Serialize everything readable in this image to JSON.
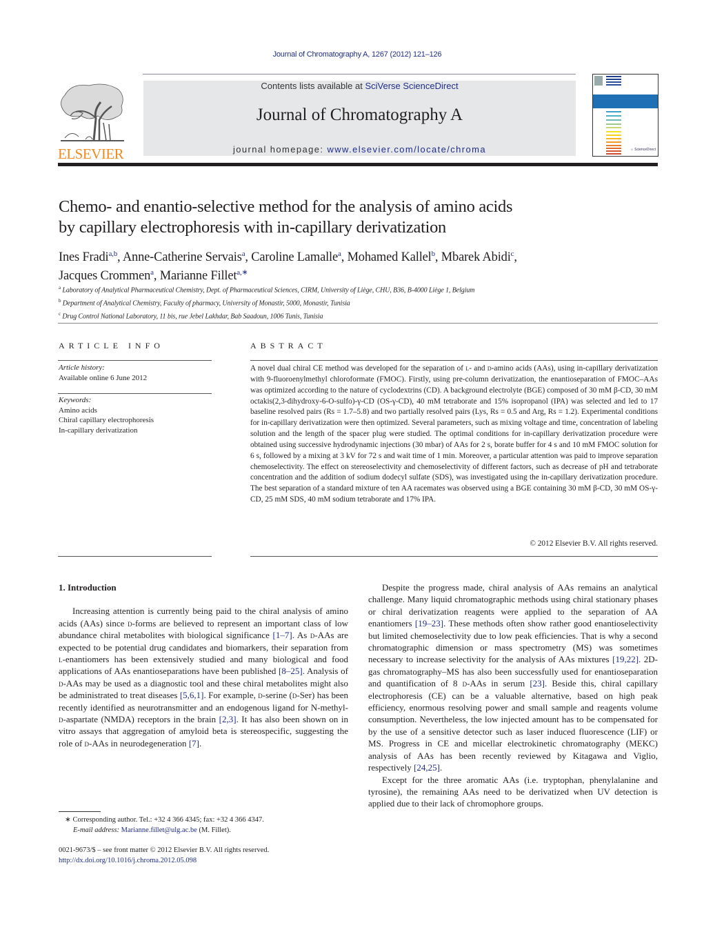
{
  "header": {
    "citation": "Journal of Chromatography A, 1267 (2012) 121–126",
    "contents_prefix": "Contents lists available at ",
    "contents_link": "SciVerse ScienceDirect",
    "journal_title": "Journal of Chromatography A",
    "homepage_prefix": "journal homepage: ",
    "homepage_link": "www.elsevier.com/locate/chroma",
    "publisher_logo": "ELSEVIER",
    "logo_icon": "elsevier-tree-icon",
    "cover_icon": "journal-cover-icon",
    "cover_colors": [
      "#1f3f8f",
      "#1f3f8f",
      "#2a4f9a",
      "#2a4f9a",
      "#1f6fb4",
      "#3aa0d0",
      "#4fb1c8",
      "#6fb8b0",
      "#9cc88a",
      "#c8d870",
      "#f4e21a",
      "#f6d31a",
      "#f4b520",
      "#ef9a24",
      "#e6802a",
      "#de6a2c",
      "#d6552e",
      "#cf4a2e"
    ]
  },
  "article": {
    "title_line1": "Chemo- and enantio-selective method for the analysis of amino acids",
    "title_line2": "by capillary electrophoresis with in-capillary derivatization",
    "authors": [
      {
        "name": "Ines Fradi",
        "aff": "a,b",
        "sep": ", "
      },
      {
        "name": "Anne-Catherine Servais",
        "aff": "a",
        "sep": ", "
      },
      {
        "name": "Caroline Lamalle",
        "aff": "a",
        "sep": ", "
      },
      {
        "name": "Mohamed Kallel",
        "aff": "b",
        "sep": ", "
      },
      {
        "name": "Mbarek Abidi",
        "aff": "c",
        "sep": ","
      },
      {
        "name": "Jacques Crommen",
        "aff": "a",
        "sep": ", "
      },
      {
        "name": "Marianne Fillet",
        "aff": "a,∗",
        "sep": ""
      }
    ],
    "affiliations": [
      {
        "key": "a",
        "text": "Laboratory of Analytical Pharmaceutical Chemistry, Dept. of Pharmaceutical Sciences, CIRM, University of Liège, CHU, B36, B-4000 Liège 1, Belgium"
      },
      {
        "key": "b",
        "text": "Department of Analytical Chemistry, Faculty of pharmacy, University of Monastir, 5000, Monastir, Tunisia"
      },
      {
        "key": "c",
        "text": "Drug Control National Laboratory, 11 bis, rue Jebel Lakhdar, Bab Saadoun, 1006 Tunis, Tunisia"
      }
    ]
  },
  "article_info": {
    "heading": "ARTICLE INFO",
    "history_label": "Article history:",
    "history_value": "Available online 6 June 2012",
    "keywords_label": "Keywords:",
    "keywords": [
      "Amino acids",
      "Chiral capillary electrophoresis",
      "In-capillary derivatization"
    ]
  },
  "abstract": {
    "heading": "ABSTRACT",
    "p1": "A novel dual chiral CE method was developed for the separation of ",
    "p1_sc1": "l",
    "p2": "- and ",
    "p2_sc2": "d",
    "p3": "-amino acids (AAs), using in-capillary derivatization with 9-fluoroenylmethyl chloroformate (FMOC). Firstly, using pre-column derivatization, the enantioseparation of FMOC–AAs was optimized according to the nature of cyclodextrins (CD). A background electrolyte (BGE) composed of 30 mM β-CD, 30 mM octakis(2,3-dihydroxy-6-O-sulfo)-γ-CD (OS-γ-CD), 40 mM tetraborate and 15% isopropanol (IPA) was selected and led to 17 baseline resolved pairs (Rs = 1.7–5.8) and two partially resolved pairs (Lys, Rs = 0.5 and Arg, Rs = 1.2). Experimental conditions for in-capillary derivatization were then optimized. Several parameters, such as mixing voltage and time, concentration of labeling solution and the length of the spacer plug were studied. The optimal conditions for in-capillary derivatization procedure were obtained using successive hydrodynamic injections (30 mbar) of AAs for 2 s, borate buffer for 4 s and 10 mM FMOC solution for 6 s, followed by a mixing at 3 kV for 72 s and wait time of 1 min. Moreover, a particular attention was paid to improve separation chemoselectivity. The effect on stereoselectivity and chemoselectivity of different factors, such as decrease of pH and tetraborate concentration and the addition of sodium dodecyl sulfate (SDS), was investigated using the in-capillary derivatization procedure. The best separation of a standard mixture of ten AA racemates was observed using a BGE containing 30 mM β-CD, 30 mM OS-γ-CD, 25 mM SDS, 40 mM sodium tetraborate and 17% IPA.",
    "copyright": "© 2012 Elsevier B.V. All rights reserved."
  },
  "body": {
    "section_heading": "1.  Introduction",
    "left_paragraph": [
      {
        "t": "Increasing attention is currently being paid to the chiral analysis of amino acids (AAs) since "
      },
      {
        "sc": "d"
      },
      {
        "t": "-forms are believed to represent an important class of low abundance chiral metabolites with biological significance "
      },
      {
        "ref": "[1–7]"
      },
      {
        "t": ". As "
      },
      {
        "sc": "d"
      },
      {
        "t": "-AAs are expected to be potential drug candidates and biomarkers, their separation from "
      },
      {
        "sc": "l"
      },
      {
        "t": "-enantiomers has been extensively studied and many biological and food applications of AAs enantioseparations have been published "
      },
      {
        "ref": "[8–25]"
      },
      {
        "t": ". Analysis of "
      },
      {
        "sc": "d"
      },
      {
        "t": "-AAs may be used as a diagnostic tool and these chiral metabolites might also be administrated to treat diseases "
      },
      {
        "ref": "[5,6,1]"
      },
      {
        "t": ". For example, "
      },
      {
        "sc": "d"
      },
      {
        "t": "-serine ("
      },
      {
        "sc": "d"
      },
      {
        "t": "-Ser) has been recently identified as neurotransmitter and an endogenous ligand for N-methyl-"
      },
      {
        "sc": "d"
      },
      {
        "t": "-aspartate (NMDA) receptors in the brain "
      },
      {
        "ref": "[2,3]"
      },
      {
        "t": ". It has also been shown on in vitro assays that aggregation of amyloid beta is stereospecific, suggesting the role of "
      },
      {
        "sc": "d"
      },
      {
        "t": "-AAs in neurodegeneration "
      },
      {
        "ref": "[7]"
      },
      {
        "t": "."
      }
    ],
    "right_paragraph_1": [
      {
        "t": "Despite the progress made, chiral analysis of AAs remains an analytical challenge. Many liquid chromatographic methods using chiral stationary phases or chiral derivatization reagents were applied to the separation of AA enantiomers "
      },
      {
        "ref": "[19–23]"
      },
      {
        "t": ". These methods often show rather good enantioselectivity but limited chemoselectivity due to low peak efficiencies. That is why a second chromatographic dimension or mass spectrometry (MS) was sometimes necessary to increase selectivity for the analysis of AAs mixtures "
      },
      {
        "ref": "[19,22]"
      },
      {
        "t": ". 2D-gas chromatography–MS has also been successfully used for enantioseparation and quantification of 8 "
      },
      {
        "sc": "d"
      },
      {
        "t": "-AAs in serum "
      },
      {
        "ref": "[23]"
      },
      {
        "t": ". Beside this, chiral capillary electrophoresis (CE) can be a valuable alternative, based on high peak efficiency, enormous resolving power and small sample and reagents volume consumption. Nevertheless, the low injected amount has to be compensated for by the use of a sensitive detector such as laser induced fluorescence (LIF) or MS. Progress in CE and micellar electrokinetic chromatography (MEKC) analysis of AAs has been recently reviewed by Kitagawa and Viglio, respectively "
      },
      {
        "ref": "[24,25]"
      },
      {
        "t": "."
      }
    ],
    "right_paragraph_2": [
      {
        "t": "Except for the three aromatic AAs (i.e. tryptophan, phenylalanine and tyrosine), the remaining AAs need to be derivatized when UV detection is applied due to their lack of chromophore groups."
      }
    ]
  },
  "footnote": {
    "star": "∗",
    "corresponding": "Corresponding author. Tel.: +32 4 366 4345; fax: +32 4 366 4347.",
    "email_label": "E-mail address:",
    "email": "Marianne.fillet@ulg.ac.be",
    "email_suffix": " (M. Fillet).",
    "front_matter": "0021-9673/$ – see front matter © 2012 Elsevier B.V. All rights reserved.",
    "doi": "http://dx.doi.org/10.1016/j.chroma.2012.05.098"
  }
}
